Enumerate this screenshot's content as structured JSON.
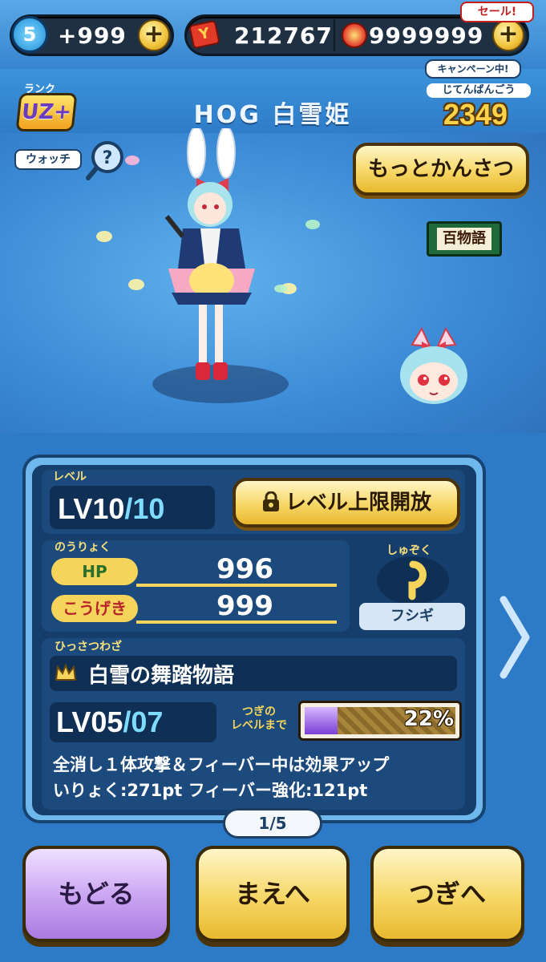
{
  "topbar": {
    "stamina_level": "5",
    "stamina_value": "+999",
    "coins": "212767",
    "gems": "9999999",
    "sale_label": "セール!",
    "campaign_label": "キャンペーン中!"
  },
  "header": {
    "rank_label": "ランク",
    "rank_value": "UZ+",
    "title": "HOG 白雪姫",
    "dex_label": "じてんばんごう",
    "dex_number": "2349"
  },
  "viewer": {
    "watch_label": "ウォッチ",
    "observe_button": "もっとかんさつ",
    "badge_label": "百物語"
  },
  "stats": {
    "level_label": "レベル",
    "level_prefix": "LV",
    "level_current": "10",
    "level_max": "/10",
    "unlock_button": "レベル上限開放",
    "ability_label": "のうりょく",
    "hp_label": "HP",
    "hp_value": "996",
    "attack_label": "こうげき",
    "attack_value": "999",
    "tribe_label": "しゅぞく",
    "tribe_value": "フシギ"
  },
  "skill": {
    "label": "ひっさつわざ",
    "name": "白雪の舞踏物語",
    "level_prefix": "LV",
    "level_current": "05",
    "level_max": "/07",
    "next_label_1": "つぎの",
    "next_label_2": "レベルまで",
    "progress_text": "22%",
    "progress": 0.22,
    "desc_line_1": "全消し１体攻撃＆フィーバー中は効果アップ",
    "desc_line_2": "いりょく:271pt フィーバー強化:121pt"
  },
  "pager": {
    "text": "1/5"
  },
  "nav": {
    "back": "もどる",
    "prev": "まえへ",
    "next": "つぎへ"
  },
  "colors": {
    "accent_yellow": "#f6d766",
    "panel_blue": "#163e6c",
    "back_purple": "#c9a3f2"
  }
}
